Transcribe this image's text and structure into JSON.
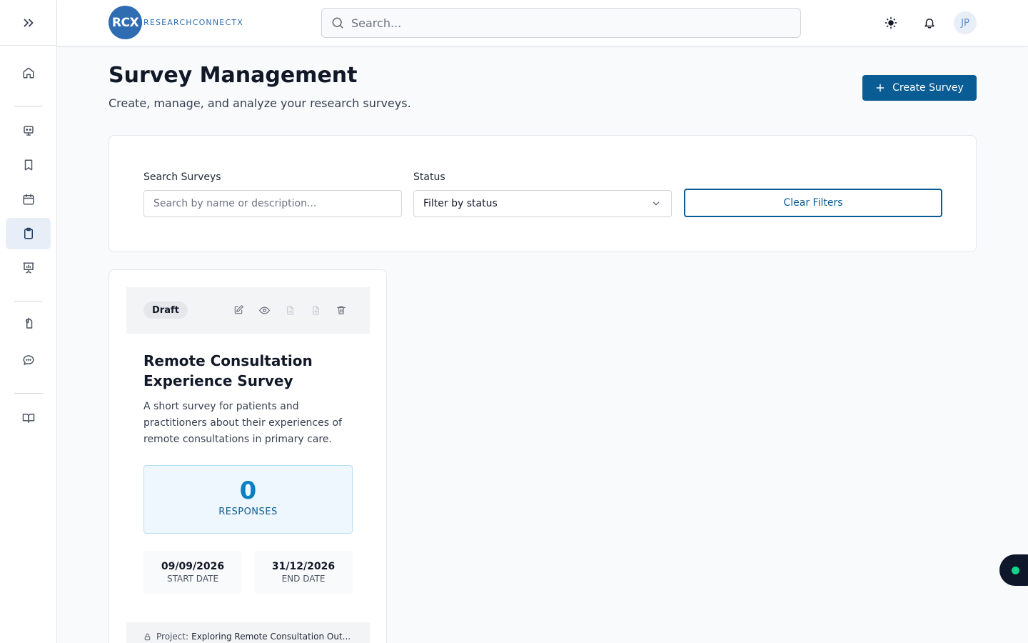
{
  "brand": {
    "logo_initials": "RCX",
    "name": "RESEARCHCONNECTX",
    "color": "#2f6db2"
  },
  "header": {
    "search_placeholder": "Search...",
    "user_initials": "JP",
    "icons": [
      "sun-icon",
      "bell-icon"
    ]
  },
  "sidebar": {
    "toggle_icon": "double-chevron-right-icon",
    "items": [
      {
        "name": "home",
        "icon": "home-icon"
      },
      {
        "name": "researchers",
        "icon": "bot-icon"
      },
      {
        "name": "saved",
        "icon": "bookmark-icon"
      },
      {
        "name": "calendar",
        "icon": "calendar-icon"
      },
      {
        "name": "surveys",
        "icon": "clipboard-icon",
        "active": true
      },
      {
        "name": "presentations",
        "icon": "presentation-chart-icon"
      },
      {
        "name": "documents",
        "icon": "file-attachment-icon"
      },
      {
        "name": "messages",
        "icon": "chat-icon"
      },
      {
        "name": "library",
        "icon": "book-open-icon"
      }
    ]
  },
  "page": {
    "title": "Survey Management",
    "subtitle": "Create, manage, and analyze your research surveys.",
    "create_label": "Create Survey"
  },
  "filters": {
    "search_label": "Search Surveys",
    "search_placeholder": "Search by name or description...",
    "status_label": "Status",
    "status_value": "Filter by status",
    "clear_label": "Clear Filters"
  },
  "surveys": [
    {
      "status": "Draft",
      "title": "Remote Consultation Experience Survey",
      "description": "A short survey for patients and practitioners about their experiences of remote consultations in primary care.",
      "responses": "0",
      "responses_label": "RESPONSES",
      "start_date": "09/09/2026",
      "start_label": "START DATE",
      "end_date": "31/12/2026",
      "end_label": "END DATE",
      "project_label": "Project:",
      "project_name": "Exploring Remote Consultation Out..."
    }
  ],
  "colors": {
    "primary": "#0a5c94",
    "accent": "#0a80c4",
    "online": "#10d48a"
  }
}
